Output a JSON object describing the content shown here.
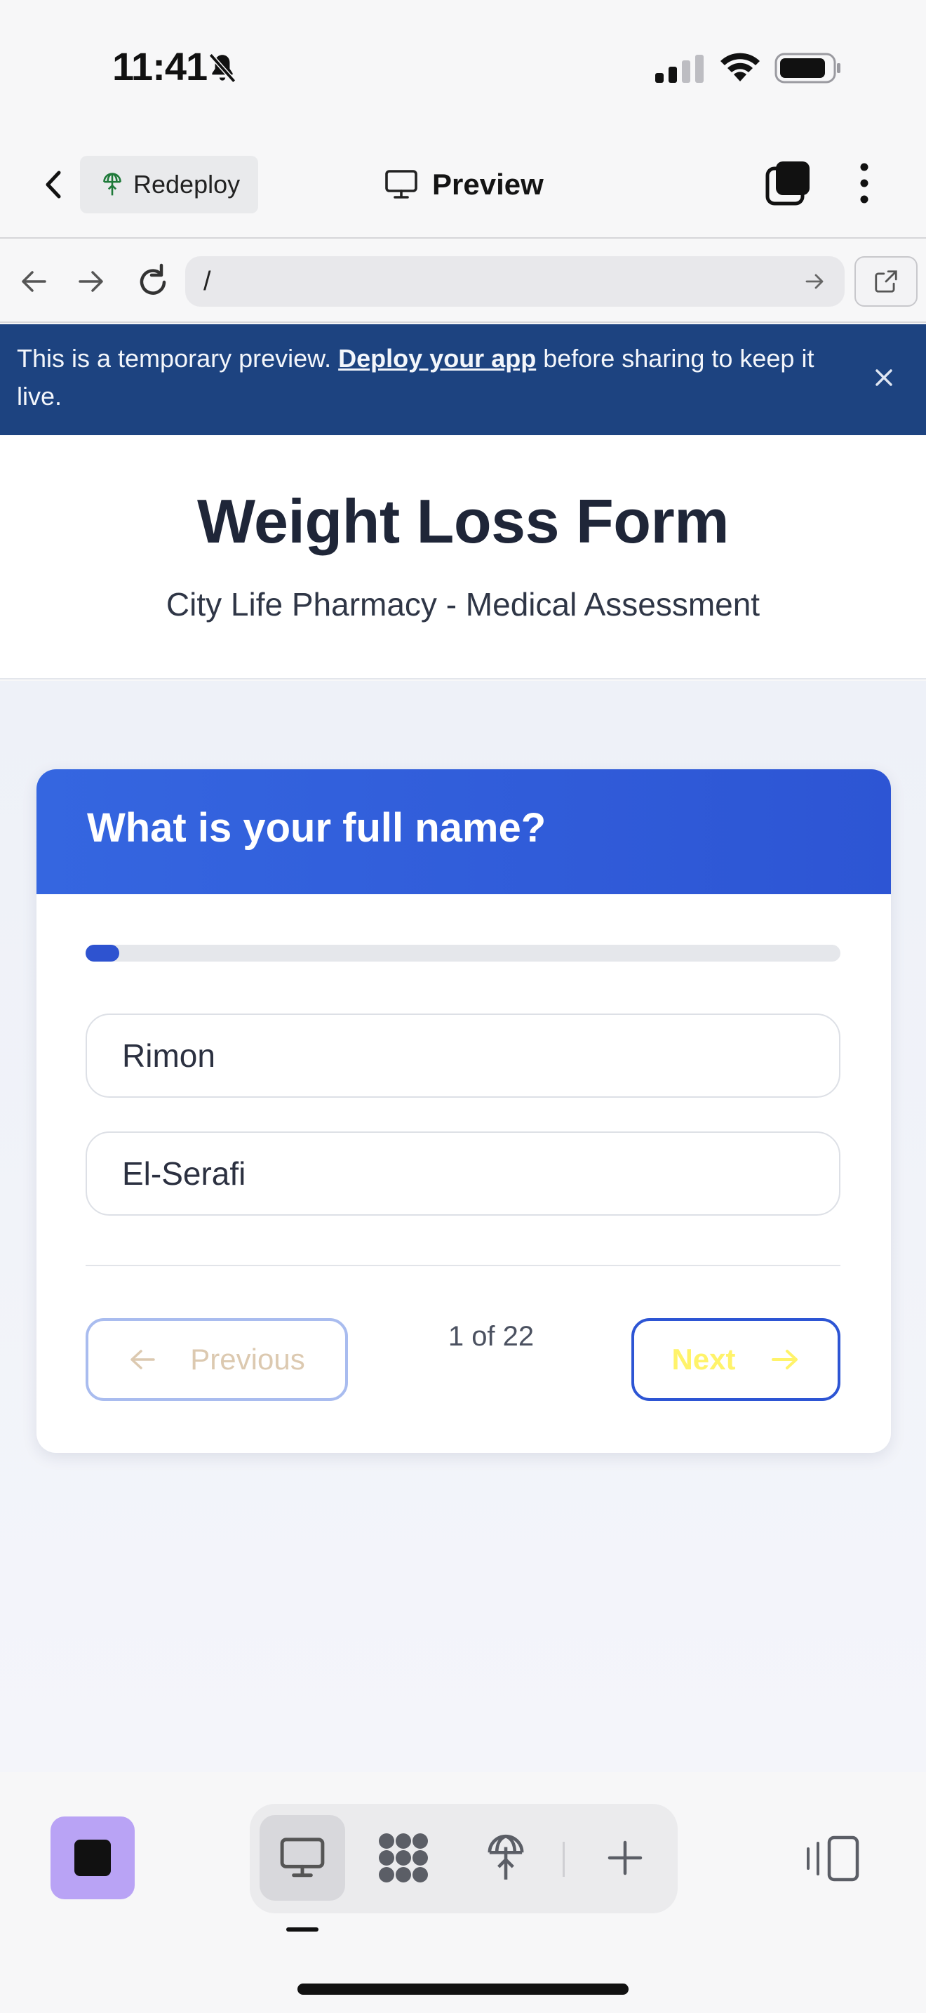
{
  "status_bar": {
    "time": "11:41",
    "icons": [
      "bell-slash-icon",
      "cellular-signal-icon",
      "wifi-icon",
      "battery-icon"
    ]
  },
  "toolbar": {
    "redeploy_label": "Redeploy",
    "preview_label": "Preview"
  },
  "browser": {
    "url": "/"
  },
  "banner": {
    "text_before": "This is a temporary preview. ",
    "link_text": "Deploy your app",
    "text_after": " before sharing to keep it live."
  },
  "page": {
    "title": "Weight Loss Form",
    "subtitle": "City Life Pharmacy - Medical Assessment"
  },
  "form": {
    "question": "What is your full name?",
    "progress_fraction": 0.045,
    "first_name_value": "Rimon",
    "last_name_value": "El-Serafi",
    "previous_label": "Previous",
    "next_label": "Next",
    "page_indicator": "1 of 22"
  },
  "colors": {
    "banner_bg": "#1d4380",
    "card_header": "#2d55d4",
    "next_text": "#fff36a",
    "previous_text": "#dcc9b0",
    "stop_button": "#b9a3f5"
  }
}
